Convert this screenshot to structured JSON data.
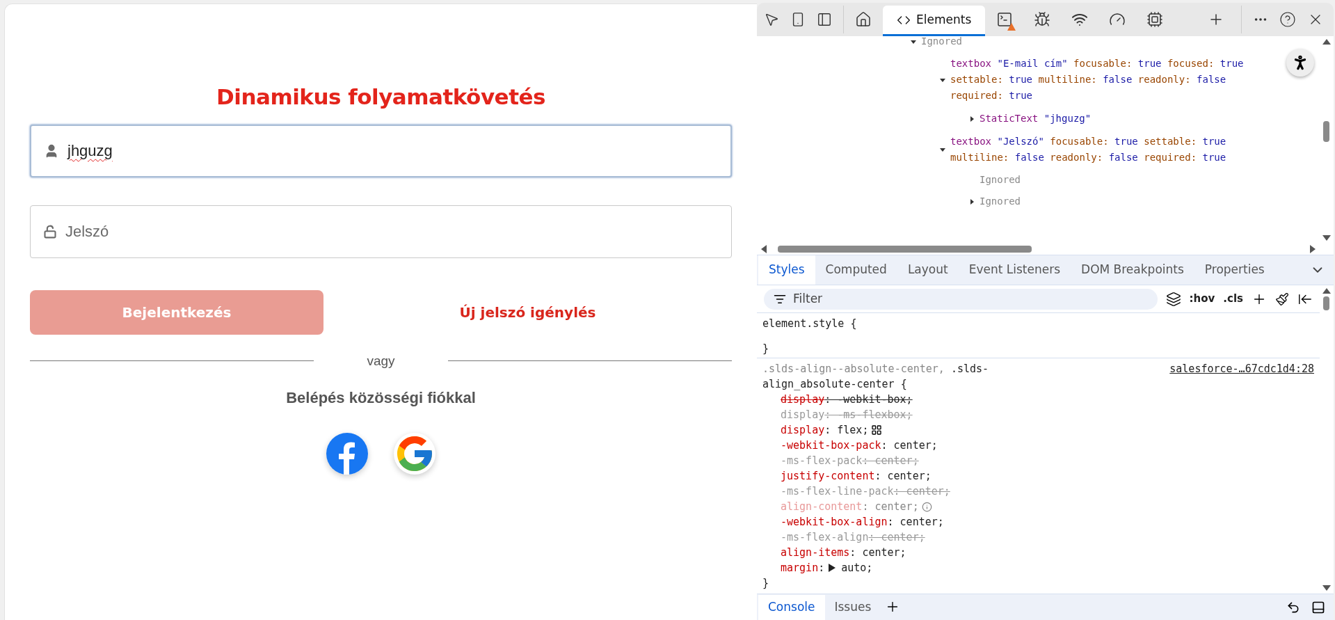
{
  "page": {
    "title": "Dinamikus folyamatkövetés",
    "username": {
      "value": "jhguzg",
      "focused": true
    },
    "password": {
      "placeholder": "Jelszó"
    },
    "login_button": "Bejelentkezés",
    "forgot_link": "Új jelszó igénylés",
    "divider": "vagy",
    "social_heading": "Belépés közösségi fiókkal"
  },
  "devtools": {
    "tabs": [
      {
        "label": "Elements",
        "selected": true
      }
    ],
    "accessibility_tree": [
      {
        "kind": "ignored",
        "label": "Ignored",
        "expanded": true,
        "children": [
          {
            "kind": "node",
            "role": "textbox",
            "name": "\"E-mail cím\"",
            "expanded": true,
            "props": [
              {
                "key": "focusable:",
                "value": "true"
              },
              {
                "key": "focused:",
                "value": "true"
              },
              {
                "key": "settable:",
                "value": "true"
              },
              {
                "key": "multiline:",
                "value": "false"
              },
              {
                "key": "readonly:",
                "value": "false"
              },
              {
                "key": "required:",
                "value": "true"
              }
            ],
            "children": [
              {
                "kind": "node",
                "role": "StaticText",
                "name": "\"jhguzg\"",
                "expanded": false
              }
            ]
          },
          {
            "kind": "node",
            "role": "textbox",
            "name": "\"Jelszó\"",
            "expanded": true,
            "props": [
              {
                "key": "focusable:",
                "value": "true"
              },
              {
                "key": "settable:",
                "value": "true"
              },
              {
                "key": "multiline:",
                "value": "false"
              },
              {
                "key": "readonly:",
                "value": "false"
              },
              {
                "key": "required:",
                "value": "true"
              }
            ],
            "children": [
              {
                "kind": "ignored",
                "label": "Ignored"
              },
              {
                "kind": "ignored",
                "label": "Ignored",
                "expanded": false
              }
            ]
          }
        ]
      }
    ],
    "styles_tabs": [
      {
        "label": "Styles",
        "selected": true
      },
      {
        "label": "Computed",
        "selected": false
      },
      {
        "label": "Layout",
        "selected": false
      },
      {
        "label": "Event Listeners",
        "selected": false
      },
      {
        "label": "DOM Breakpoints",
        "selected": false
      },
      {
        "label": "Properties",
        "selected": false
      }
    ],
    "filter": {
      "placeholder": "Filter"
    },
    "toolbar_labels": [
      ":hov",
      ".cls"
    ],
    "rules": [
      {
        "selector": [
          {
            "text": "element.style",
            "matched": true
          }
        ],
        "open": "{",
        "close": "}"
      },
      {
        "selector": [
          {
            "text": ".slds-align--absolute-center,",
            "matched": false
          },
          {
            "text": ".slds-align_absolute-center",
            "matched": true
          }
        ],
        "open": "{",
        "close": "}",
        "source": "salesforce-…67cdc1d4:28",
        "declarations": [
          {
            "name": "display",
            "value": ": -webkit-box;",
            "kind": "overridden"
          },
          {
            "name": "display",
            "value": ": -ms-flexbox;",
            "kind": "unsupported"
          },
          {
            "name": "display",
            "value": ": flex;",
            "kind": "active",
            "flex_editor": true
          },
          {
            "name": "-webkit-box-pack",
            "value": ": center;",
            "kind": "active"
          },
          {
            "name": "-ms-flex-pack",
            "value": ": center;",
            "kind": "unsupported"
          },
          {
            "name": "justify-content",
            "value": ": center;",
            "kind": "active"
          },
          {
            "name": "-ms-flex-line-pack",
            "value": ": center;",
            "kind": "unsupported"
          },
          {
            "name": "align-content",
            "value": ": center;",
            "kind": "inactive"
          },
          {
            "name": "-webkit-box-align",
            "value": ": center;",
            "kind": "active"
          },
          {
            "name": "-ms-flex-align",
            "value": ": center;",
            "kind": "unsupported"
          },
          {
            "name": "align-items",
            "value": ": center;",
            "kind": "active"
          },
          {
            "name": "margin",
            "colon": ":",
            "value": "auto;",
            "kind": "active",
            "expandable": true
          }
        ]
      }
    ],
    "drawer_tabs": [
      {
        "label": "Console",
        "selected": true
      },
      {
        "label": "Issues",
        "selected": false
      }
    ]
  }
}
